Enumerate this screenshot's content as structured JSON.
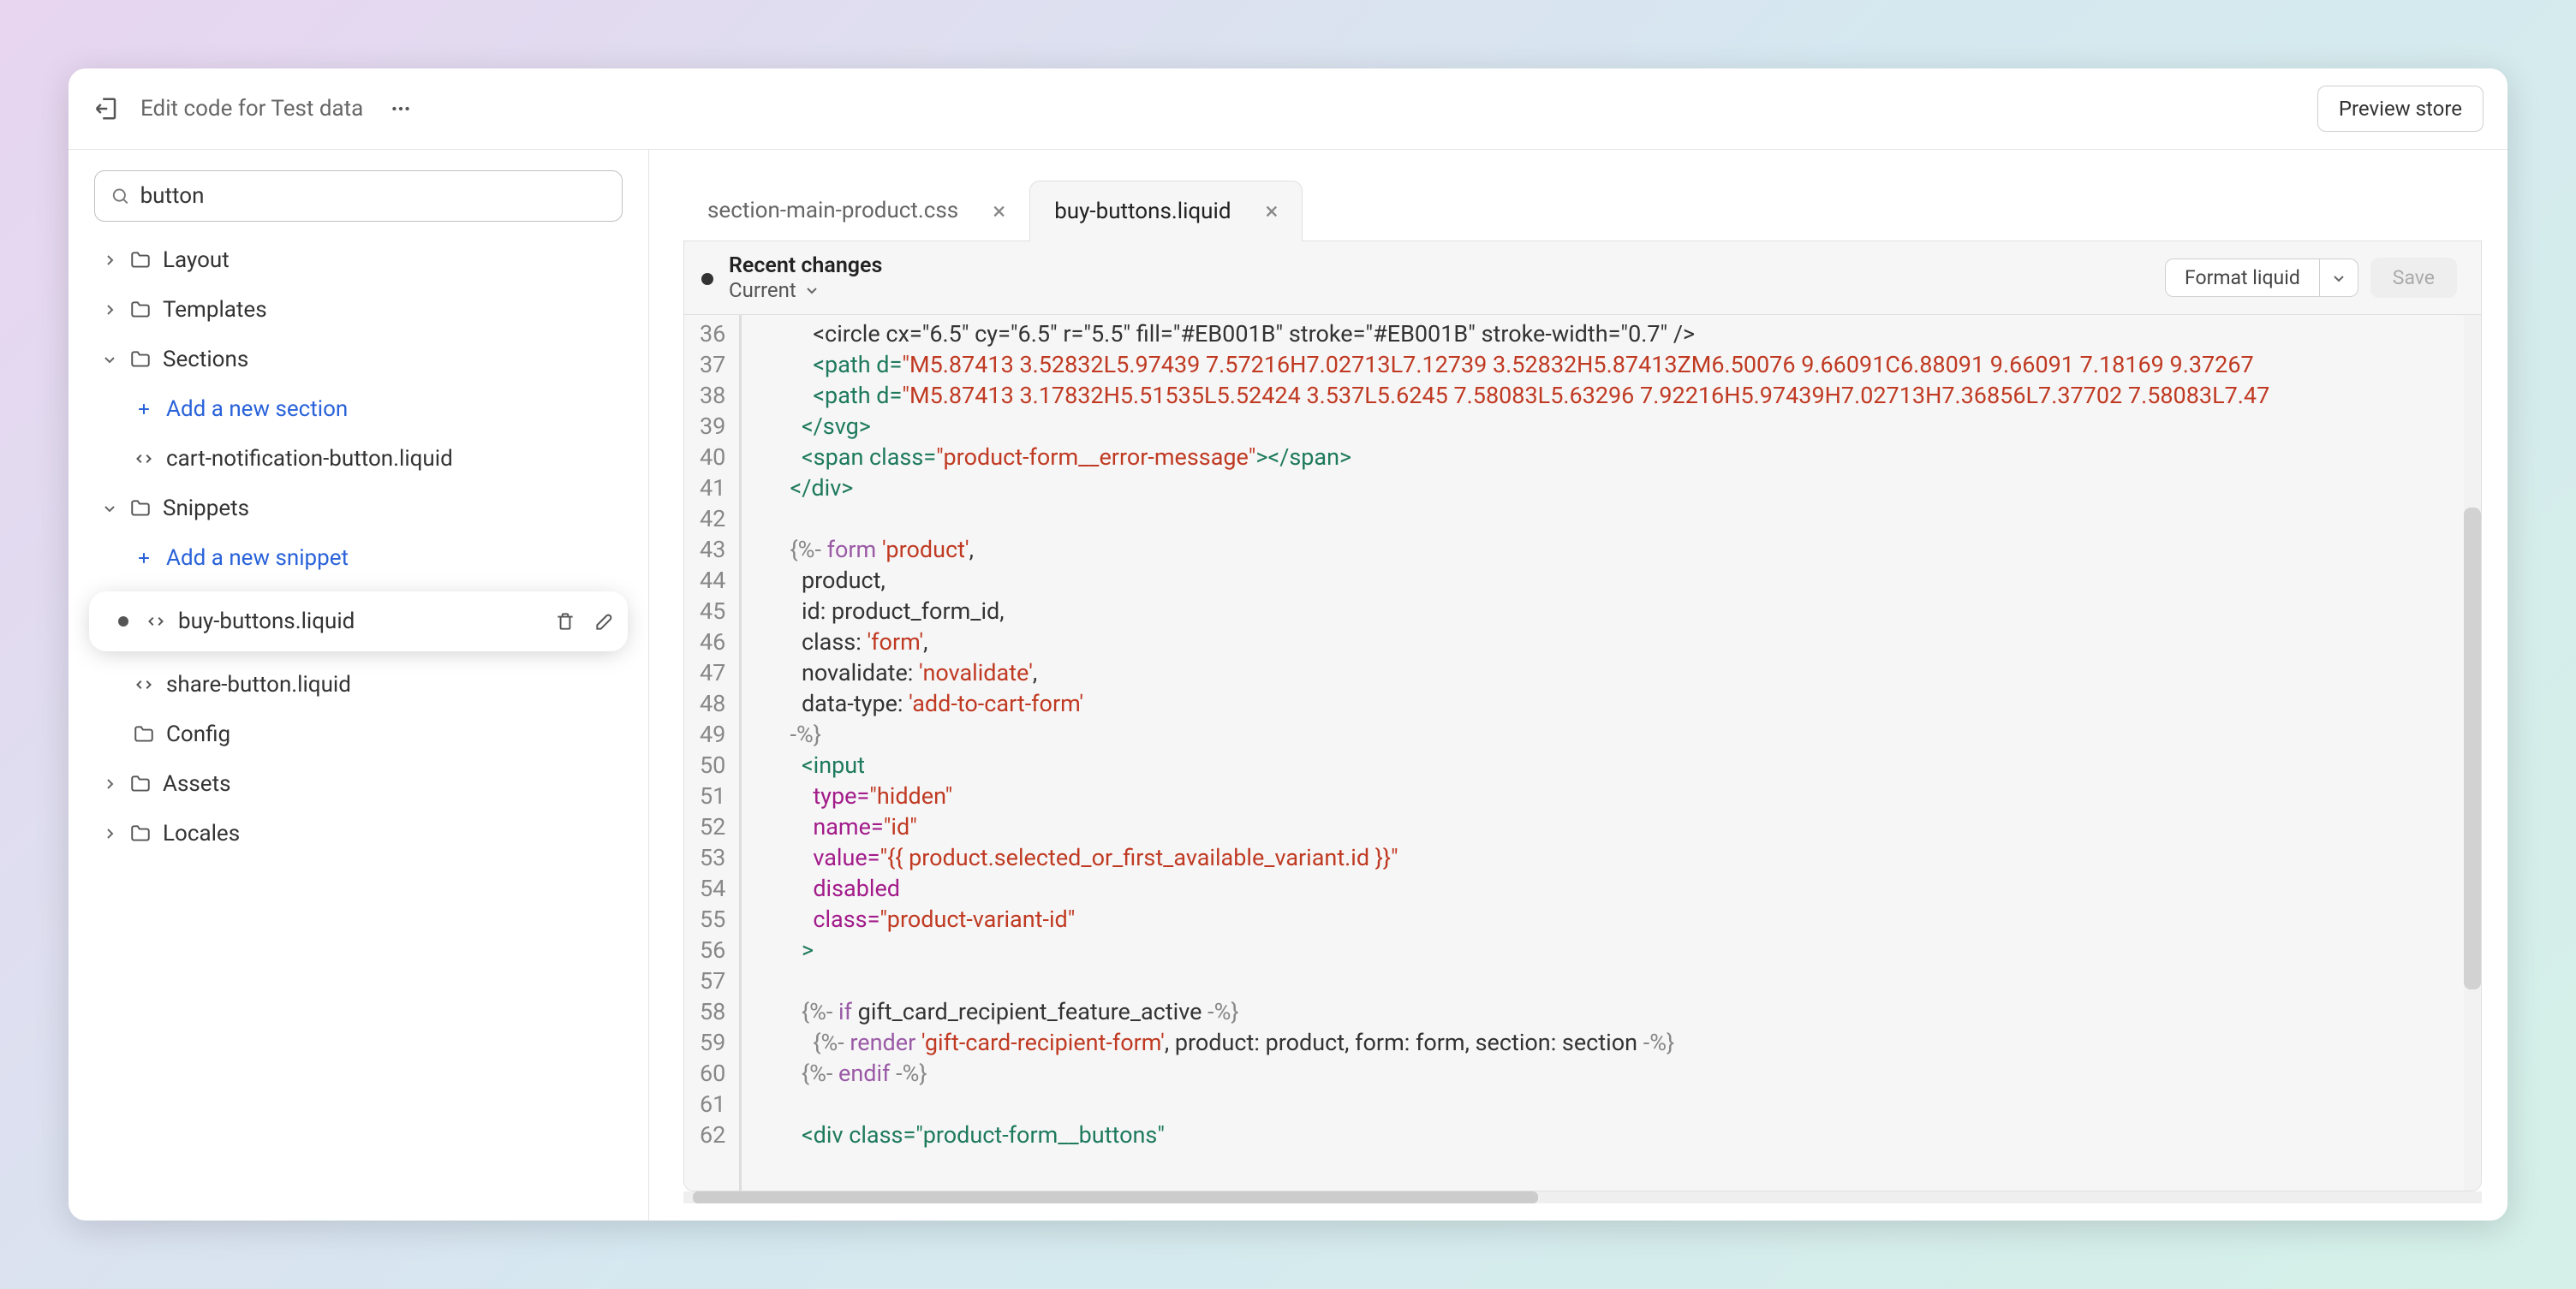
{
  "header": {
    "title": "Edit code for Test data",
    "preview_label": "Preview store"
  },
  "search": {
    "value": "button"
  },
  "tree": {
    "layout": "Layout",
    "templates": "Templates",
    "sections": "Sections",
    "add_section": "Add a new section",
    "file_cart_notification": "cart-notification-button.liquid",
    "snippets": "Snippets",
    "add_snippet": "Add a new snippet",
    "file_buy_buttons": "buy-buttons.liquid",
    "file_share_button": "share-button.liquid",
    "config": "Config",
    "assets": "Assets",
    "locales": "Locales"
  },
  "tabs": {
    "css": "section-main-product.css",
    "liquid": "buy-buttons.liquid"
  },
  "editbar": {
    "recent_changes": "Recent changes",
    "current": "Current",
    "format": "Format liquid",
    "save": "Save"
  },
  "code": {
    "lines_start": 36,
    "lines_end": 62,
    "l36": "          <circle cx=\"6.5\" cy=\"6.5\" r=\"5.5\" fill=\"#EB001B\" stroke=\"#EB001B\" stroke-width=\"0.7\" />",
    "l37_a": "          <path d=",
    "l37_b": "\"M5.87413 3.52832L5.97439 7.57216H7.02713L7.12739 3.52832H5.87413ZM6.50076 9.66091C6.88091 9.66091 7.18169 9.37267",
    "l38_a": "          <path d=",
    "l38_b": "\"M5.87413 3.17832H5.51535L5.52424 3.537L5.6245 7.58083L5.63296 7.92216H5.97439H7.02713H7.36856L7.37702 7.58083L7.47",
    "l39": "        </svg>",
    "l40_a": "        <span class=",
    "l40_b": "\"product-form__error-message\"",
    "l40_c": "></span>",
    "l41": "      </div>",
    "l43_a": "      {%- ",
    "l43_b": "form",
    "l43_c": " 'product'",
    "l43_d": ",",
    "l44": "        product,",
    "l45": "        id: product_form_id,",
    "l46_a": "        class: ",
    "l46_b": "'form'",
    "l46_c": ",",
    "l47_a": "        novalidate: ",
    "l47_b": "'novalidate'",
    "l47_c": ",",
    "l48_a": "        data-type: ",
    "l48_b": "'add-to-cart-form'",
    "l49": "      -%}",
    "l50": "        <input",
    "l51_a": "          type=",
    "l51_b": "\"hidden\"",
    "l52_a": "          name=",
    "l52_b": "\"id\"",
    "l53_a": "          value=",
    "l53_b": "\"{{ product.selected_or_first_available_variant.id }}\"",
    "l54": "          disabled",
    "l55_a": "          class=",
    "l55_b": "\"product-variant-id\"",
    "l56": "        >",
    "l58_a": "        {%- ",
    "l58_b": "if",
    "l58_c": " gift_card_recipient_feature_active ",
    "l58_d": "-%}",
    "l59_a": "          {%- ",
    "l59_b": "render",
    "l59_c": " 'gift-card-recipient-form'",
    "l59_d": ", product: product, form: form, section: section ",
    "l59_e": "-%}",
    "l60_a": "        {%- ",
    "l60_b": "endif",
    "l60_c": " -%}",
    "l62": "        <div class=\"product-form__buttons\""
  }
}
